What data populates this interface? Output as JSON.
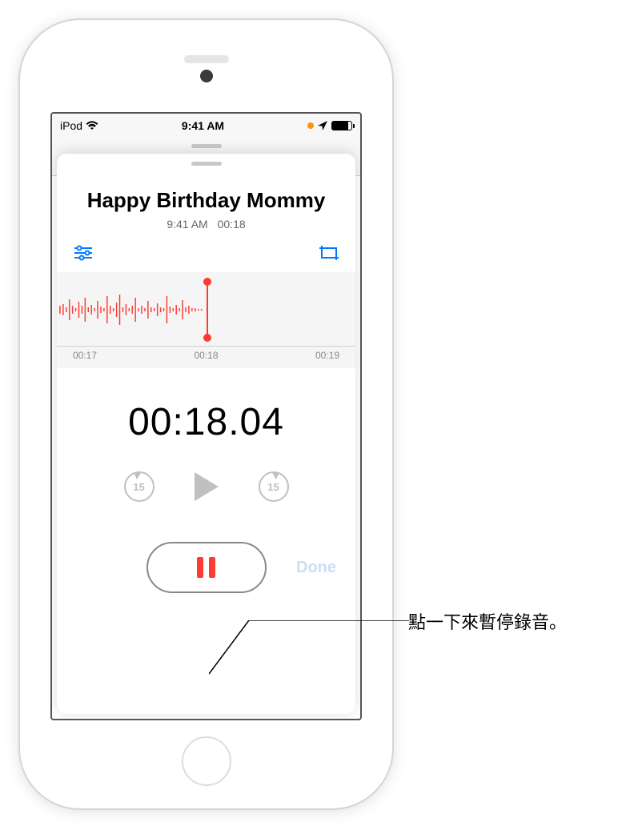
{
  "status_bar": {
    "carrier": "iPod",
    "time": "9:41 AM"
  },
  "recording": {
    "title": "Happy Birthday Mommy",
    "time_label": "9:41 AM",
    "duration_label": "00:18",
    "current_time": "00:18.04"
  },
  "ruler": {
    "tick1": "00:17",
    "tick2": "00:18",
    "tick3": "00:19"
  },
  "controls": {
    "skip_back_label": "15",
    "skip_forward_label": "15",
    "done_label": "Done"
  },
  "callout": {
    "pause_text": "點一下來暫停錄音。"
  },
  "colors": {
    "accent_red": "#ff3b30",
    "accent_blue": "#007aff",
    "recording_orange": "#ff9500"
  }
}
